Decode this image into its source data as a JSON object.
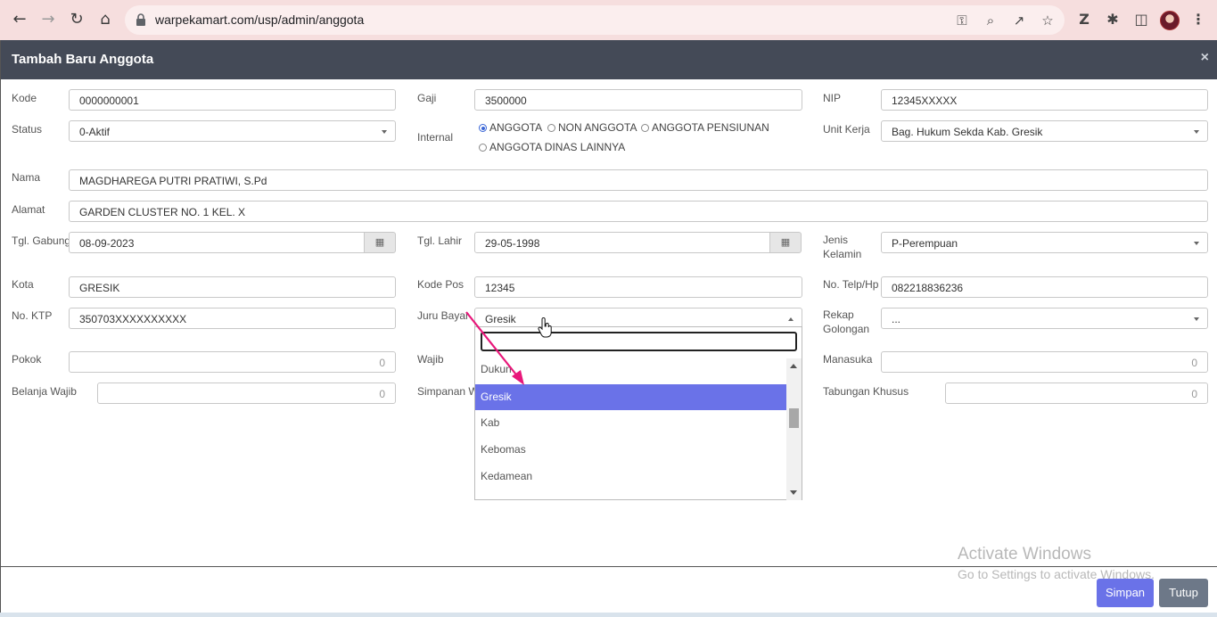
{
  "browser": {
    "url": "warpekamart.com/usp/admin/anggota"
  },
  "modal": {
    "title": "Tambah Baru Anggota",
    "close_glyph": "×"
  },
  "form": {
    "kode": {
      "label": "Kode",
      "value": "0000000001"
    },
    "gaji": {
      "label": "Gaji",
      "value": "3500000"
    },
    "nip": {
      "label": "NIP",
      "value": "12345XXXXX"
    },
    "status": {
      "label": "Status",
      "value": "0-Aktif"
    },
    "internal": {
      "label": "Internal",
      "options": [
        "ANGGOTA",
        "NON ANGGOTA",
        "ANGGOTA PENSIUNAN",
        "ANGGOTA DINAS LAINNYA"
      ],
      "selected": "ANGGOTA"
    },
    "unit_kerja": {
      "label": "Unit Kerja",
      "value": "Bag. Hukum Sekda Kab. Gresik"
    },
    "nama": {
      "label": "Nama",
      "value": "MAGDHAREGA PUTRI PRATIWI, S.Pd"
    },
    "alamat": {
      "label": "Alamat",
      "value": "GARDEN CLUSTER NO. 1 KEL. X"
    },
    "tgl_gabung": {
      "label": "Tgl. Gabung",
      "value": "08-09-2023"
    },
    "tgl_lahir": {
      "label": "Tgl. Lahir",
      "value": "29-05-1998"
    },
    "jenis_kelamin": {
      "label_line1": "Jenis",
      "label_line2": "Kelamin",
      "value": "P-Perempuan"
    },
    "kota": {
      "label": "Kota",
      "value": "GRESIK"
    },
    "kode_pos": {
      "label": "Kode Pos",
      "value": "12345"
    },
    "telp": {
      "label": "No. Telp/Hp",
      "value": "082218836236"
    },
    "ktp": {
      "label": "No. KTP",
      "value": "350703XXXXXXXXXX"
    },
    "juru_bayar": {
      "label": "Juru Bayar",
      "value": "Gresik"
    },
    "rekap_golongan": {
      "label_line1": "Rekap",
      "label_line2": "Golongan",
      "value": "..."
    },
    "pokok": {
      "label": "Pokok",
      "value": "0"
    },
    "wajib": {
      "label": "Wajib"
    },
    "manasuka": {
      "label": "Manasuka",
      "value": "0"
    },
    "belanja_wajib": {
      "label": "Belanja Wajib",
      "value": "0"
    },
    "simpanan": {
      "label": "Simpanan W"
    },
    "tabungan_khusus": {
      "label": "Tabungan Khusus",
      "value": "0"
    }
  },
  "juru_bayar_dropdown": {
    "search_value": "",
    "options": [
      "Dukun",
      "Gresik",
      "Kab",
      "Kebomas",
      "Kedamean"
    ],
    "highlighted": "Gresik"
  },
  "footer": {
    "save_label": "Simpan",
    "close_label": "Tutup"
  },
  "watermark": {
    "line1": "Activate Windows",
    "line2": "Go to Settings to activate Windows."
  },
  "colors": {
    "primary": "#6a72e8",
    "header": "#444a57",
    "annotation_arrow": "#e8177a"
  }
}
